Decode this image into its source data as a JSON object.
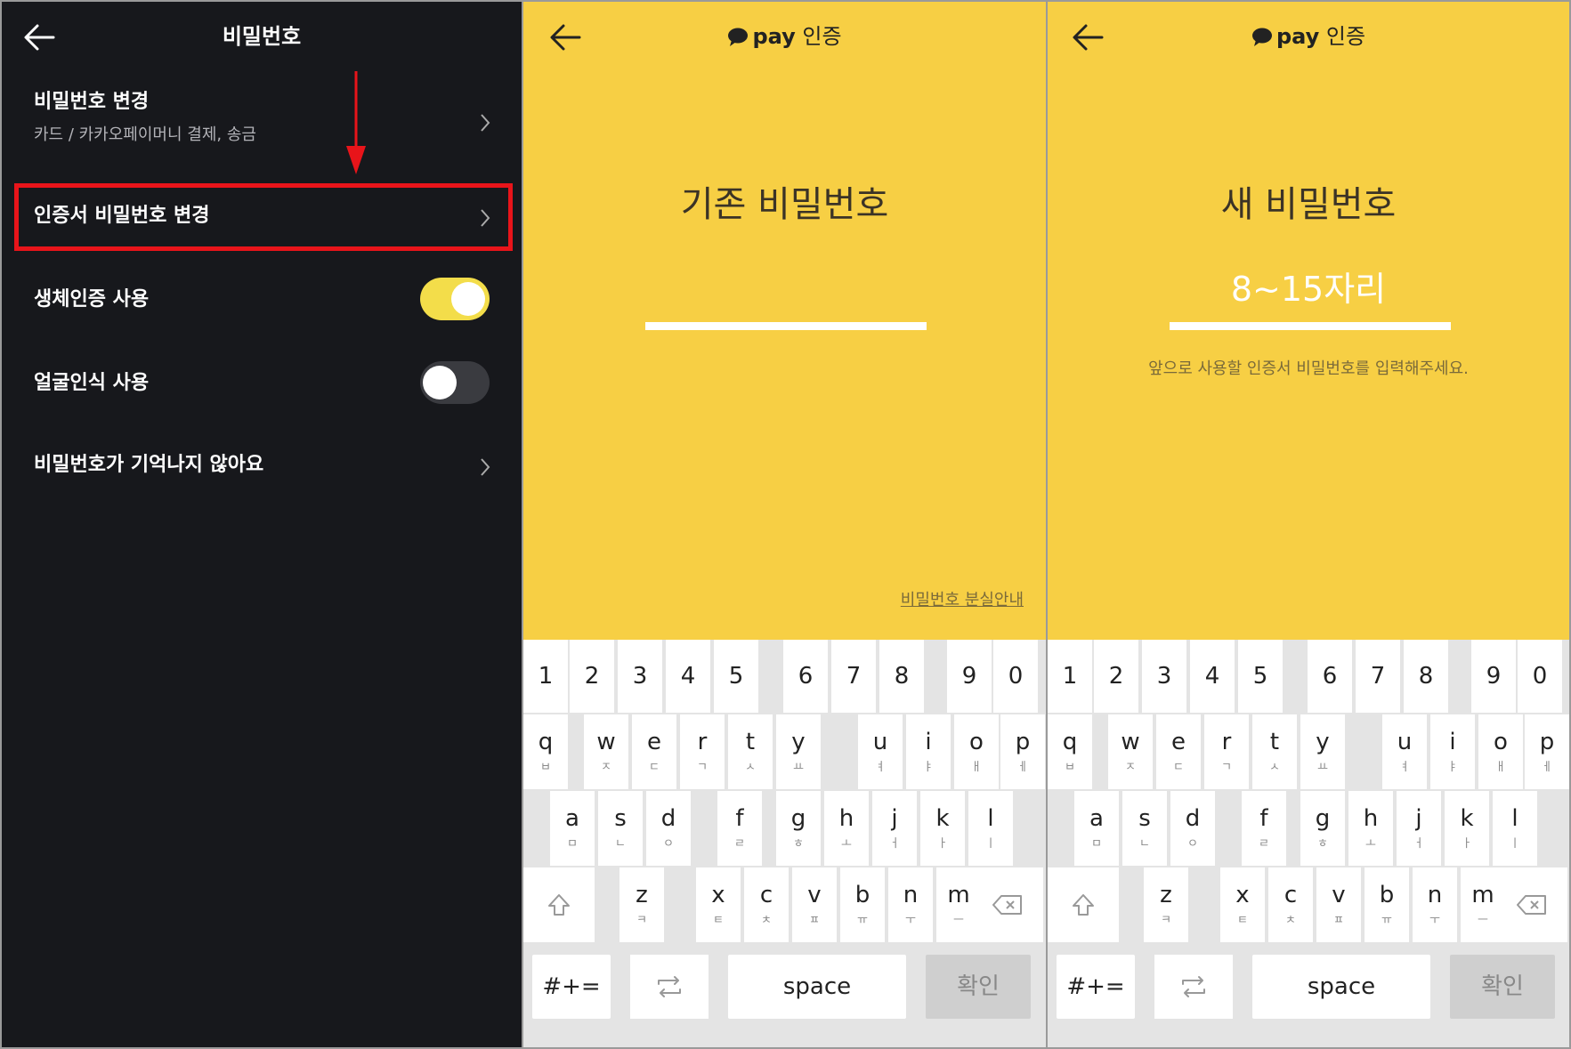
{
  "panel1": {
    "title": "비밀번호",
    "items": [
      {
        "title": "비밀번호 변경",
        "subtitle": "카드 / 카카오페이머니 결제, 송금"
      },
      {
        "title": "인증서 비밀번호 변경"
      },
      {
        "title": "생체인증 사용",
        "toggle": "on"
      },
      {
        "title": "얼굴인식 사용",
        "toggle": "off"
      },
      {
        "title": "비밀번호가 기억나지 않아요"
      }
    ],
    "colors": {
      "background": "#17181c",
      "highlight": "#e8141a",
      "toggle_on": "#f3dd4a"
    }
  },
  "panel2": {
    "logo_pay": "pay",
    "logo_text": "인증",
    "heading": "기존 비밀번호",
    "forgot_link": "비밀번호 분실안내"
  },
  "panel3": {
    "logo_pay": "pay",
    "logo_text": "인증",
    "heading": "새 비밀번호",
    "hint": "8~15자리",
    "description": "앞으로 사용할 인증서 비밀번호를 입력해주세요."
  },
  "keyboard": {
    "numbers": [
      "1",
      "2",
      "3",
      "4",
      "5",
      "6",
      "7",
      "8",
      "9",
      "0"
    ],
    "row1": [
      [
        "q",
        "ㅂ"
      ],
      [
        "w",
        "ㅈ"
      ],
      [
        "e",
        "ㄷ"
      ],
      [
        "r",
        "ㄱ"
      ],
      [
        "t",
        "ㅅ"
      ],
      [
        "y",
        "ㅛ"
      ],
      [
        "u",
        "ㅕ"
      ],
      [
        "i",
        "ㅑ"
      ],
      [
        "o",
        "ㅐ"
      ],
      [
        "p",
        "ㅔ"
      ]
    ],
    "row2": [
      [
        "a",
        "ㅁ"
      ],
      [
        "s",
        "ㄴ"
      ],
      [
        "d",
        "ㅇ"
      ],
      [
        "f",
        "ㄹ"
      ],
      [
        "g",
        "ㅎ"
      ],
      [
        "h",
        "ㅗ"
      ],
      [
        "j",
        "ㅓ"
      ],
      [
        "k",
        "ㅏ"
      ],
      [
        "l",
        "ㅣ"
      ]
    ],
    "row3": [
      [
        "z",
        "ㅋ"
      ],
      [
        "x",
        "ㅌ"
      ],
      [
        "c",
        "ㅊ"
      ],
      [
        "v",
        "ㅍ"
      ],
      [
        "b",
        "ㅠ"
      ],
      [
        "n",
        "ㅜ"
      ],
      [
        "m",
        "ㅡ"
      ]
    ],
    "symbols_label": "#+=",
    "space_label": "space",
    "confirm_label": "확인",
    "shift_icon": "shift-icon",
    "backspace_icon": "backspace-icon",
    "swap_icon": "swap-icon",
    "colors": {
      "bg": "#e4e4e4",
      "key": "#ffffff",
      "confirm": "#cfcfcf"
    }
  }
}
